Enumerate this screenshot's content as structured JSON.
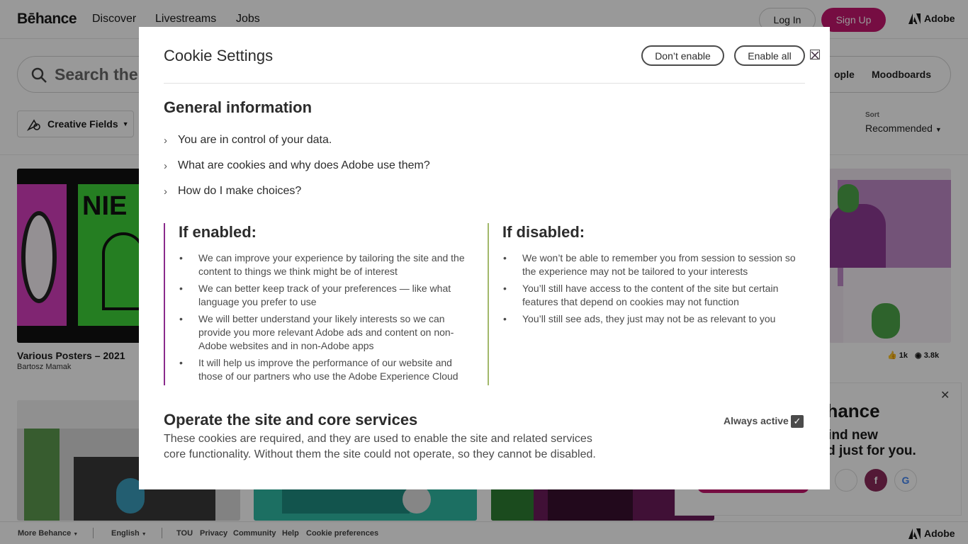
{
  "header": {
    "logo": "Bēhance",
    "nav": [
      "Discover",
      "Livestreams",
      "Jobs"
    ],
    "login": "Log In",
    "signup": "Sign Up",
    "adobe": "Adobe"
  },
  "search": {
    "placeholder_visible": "Search the c",
    "tabs": [
      "ople",
      "Moodboards"
    ]
  },
  "filters": {
    "creative_fields": "Creative Fields",
    "sort_label": "Sort",
    "sort_value": "Recommended"
  },
  "cards": [
    {
      "title": "Various Posters – 2021",
      "owner": "Bartosz Mamak"
    },
    {
      "likes": "1k",
      "views": "3.8k"
    }
  ],
  "promo": {
    "title": "ehance",
    "text": ". Find new\nked just for you.",
    "social": [
      "facebook-icon",
      "google-icon"
    ]
  },
  "footer": {
    "more": "More Behance",
    "language": "English",
    "links": [
      "TOU",
      "Privacy",
      "Community",
      "Help",
      "Cookie preferences"
    ],
    "adobe": "Adobe"
  },
  "modal": {
    "title": "Cookie Settings",
    "dont_enable": "Don’t enable",
    "enable_all": "Enable all",
    "general_heading": "General information",
    "accordion": [
      "You are in control of your data.",
      "What are cookies and why does Adobe use them?",
      "How do I make choices?"
    ],
    "enabled_heading": "If enabled:",
    "enabled_items": [
      "We can improve your experience by tailoring the site and the content to things we think might be of interest",
      "We can better keep track of your preferences — like what language you prefer to use",
      "We will better understand your likely interests so we can provide you more relevant Adobe ads and content on non-Adobe websites and in non-Adobe apps",
      "It will help us improve the performance of our website and those of our partners who use the Adobe Experience Cloud"
    ],
    "disabled_heading": "If disabled:",
    "disabled_items": [
      "We won’t be able to remember you from session to session so the experience may not be tailored to your interests",
      "You’ll still have access to the content of the site but certain features that depend on cookies may not function",
      "You’ll still see ads, they just may not be as relevant to you"
    ],
    "operate_heading": "Operate the site and core services",
    "operate_desc": "These cookies are required, and they are used to enable the site and related services core functionality. Without them the site could not operate, so they cannot be disabled.",
    "always_active": "Always active"
  },
  "colors": {
    "brand": "#c5176f",
    "enabled_rule": "#8a2b8c",
    "disabled_rule": "#a2b86a"
  }
}
